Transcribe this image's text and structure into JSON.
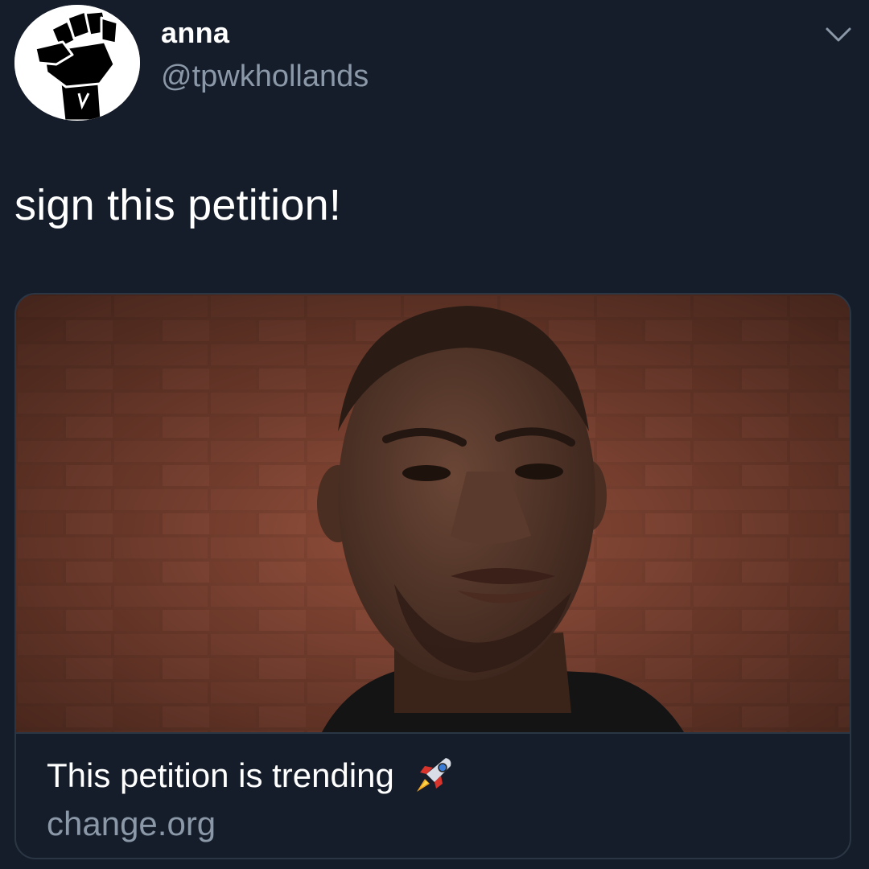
{
  "user": {
    "display_name": "anna",
    "handle": "@tpwkhollands",
    "avatar_icon": "raised-fist-icon"
  },
  "menu": {
    "icon": "chevron-down-icon"
  },
  "tweet": {
    "text": "sign this petition!"
  },
  "card": {
    "title": "This petition is trending",
    "title_icon": "rocket-icon",
    "domain": "change.org"
  },
  "colors": {
    "background": "#151d2a",
    "secondary_text": "#8b98a8",
    "border": "#2b3645"
  }
}
